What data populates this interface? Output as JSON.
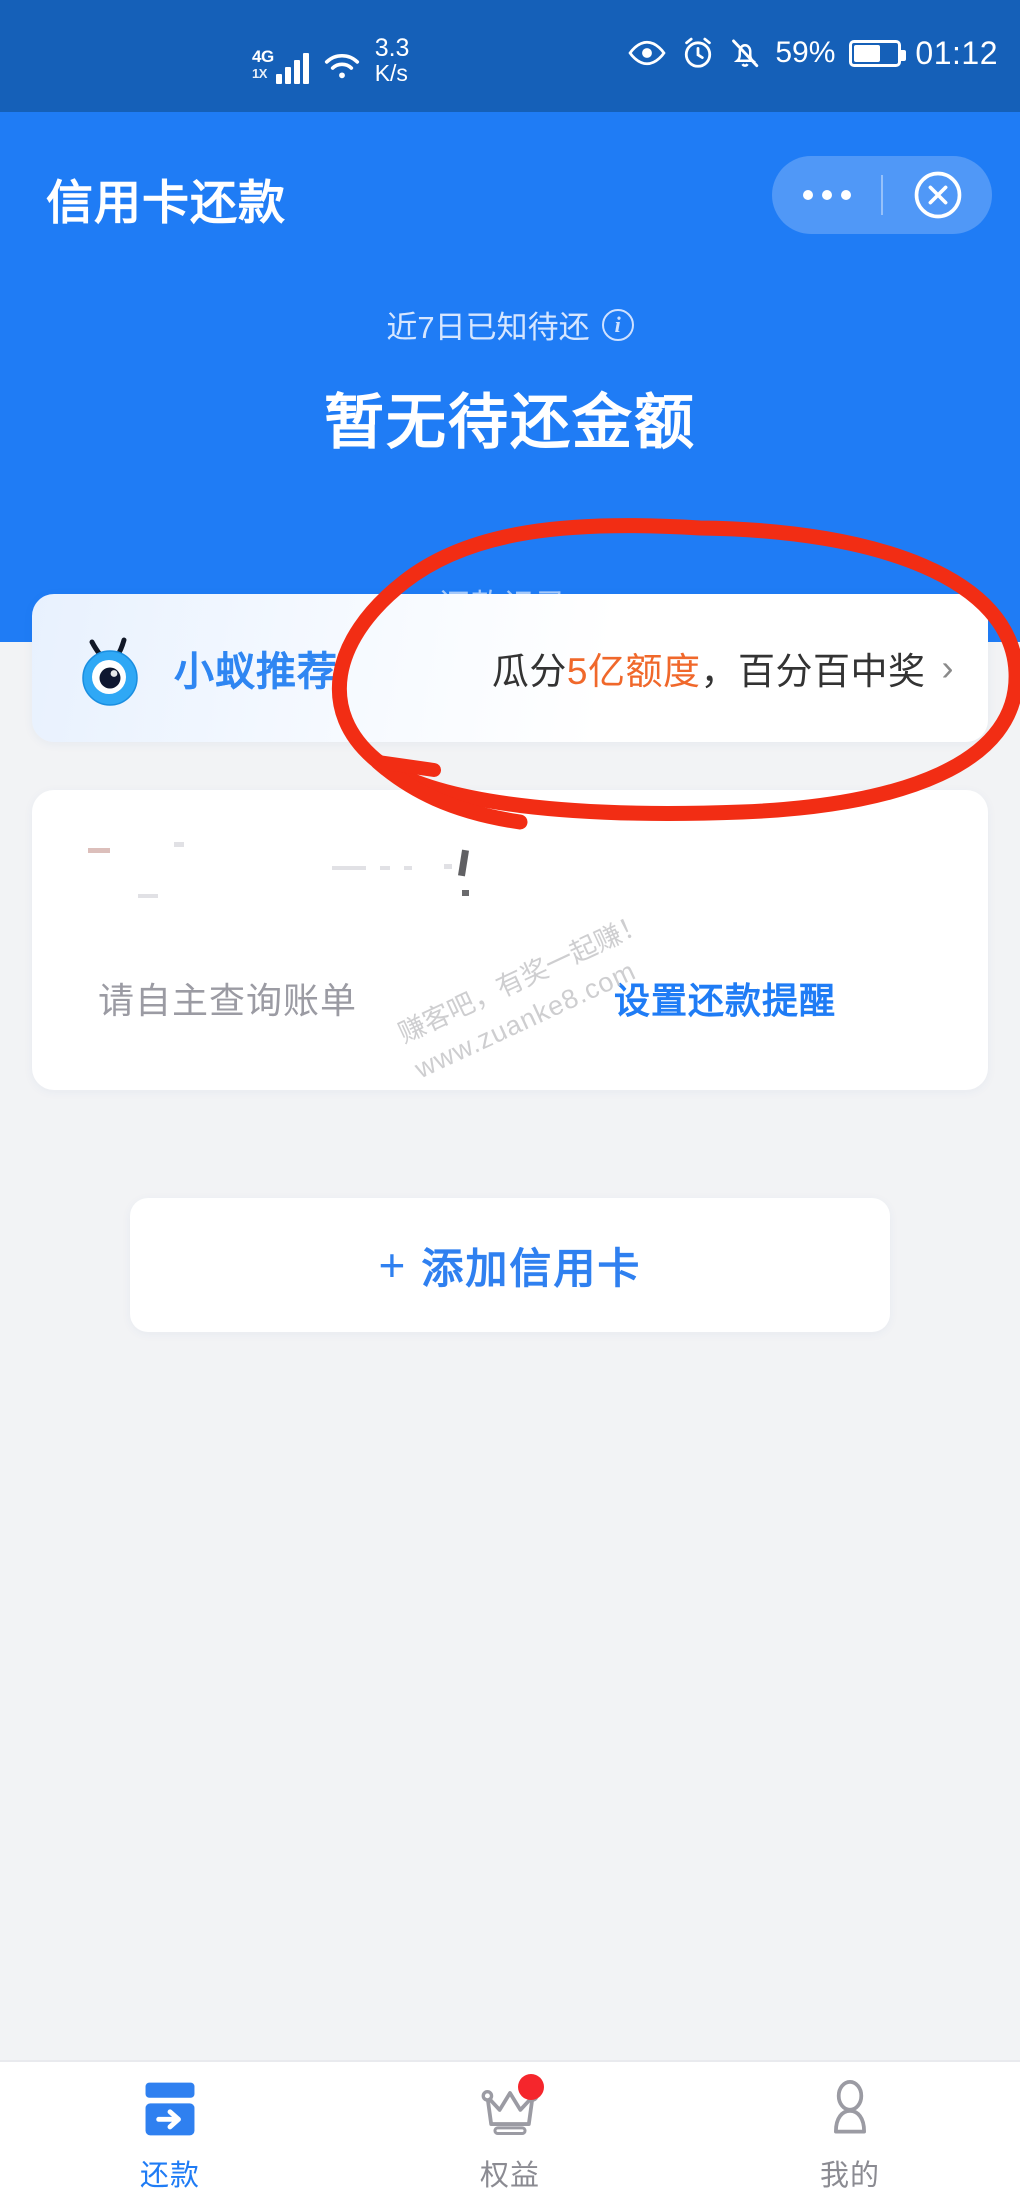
{
  "status_bar": {
    "network_type": "4G",
    "network_sub": "1X",
    "speed_value": "3.3",
    "speed_unit": "K/s",
    "battery_percent": "59%",
    "time": "01:12",
    "icons": [
      "eye-icon",
      "alarm-clock-icon",
      "bell-muted-icon",
      "battery-icon"
    ]
  },
  "header": {
    "title": "信用卡还款",
    "capsule": {
      "more_label": "•••",
      "close_label": "✕"
    }
  },
  "hero": {
    "subtitle": "近7日已知待还",
    "info_glyph": "i",
    "amount_text": "暂无待还金额",
    "records_link": "还款记录",
    "chevron": "›"
  },
  "banner": {
    "brand": "小蚁推荐",
    "promo_prefix": "瓜分",
    "promo_highlight": "5亿额度",
    "promo_suffix": "，百分百中奖",
    "chevron": "›",
    "highlight_color": "#f0682b"
  },
  "bill_card": {
    "hint": "请自主查询账单",
    "action": "设置还款提醒"
  },
  "add_card": {
    "plus": "+",
    "label": "添加信用卡"
  },
  "watermark": {
    "line1": "赚客吧，有奖一起赚！",
    "line2": "www.zuanke8.com"
  },
  "annotation": {
    "shape": "hand-drawn-red-ellipse-with-arrow",
    "color": "#f22d14"
  },
  "tabbar": {
    "items": [
      {
        "label": "还款",
        "icon": "credit-card-arrow-icon",
        "active": true,
        "badge": false
      },
      {
        "label": "权益",
        "icon": "crown-icon",
        "active": false,
        "badge": true
      },
      {
        "label": "我的",
        "icon": "person-icon",
        "active": false,
        "badge": false
      }
    ]
  },
  "colors": {
    "status_bar_bg": "#1560b8",
    "hero_bg": "#1f7cf5",
    "page_bg": "#f2f3f5",
    "accent_blue": "#1f7cf5",
    "badge_red": "#f5262c"
  }
}
